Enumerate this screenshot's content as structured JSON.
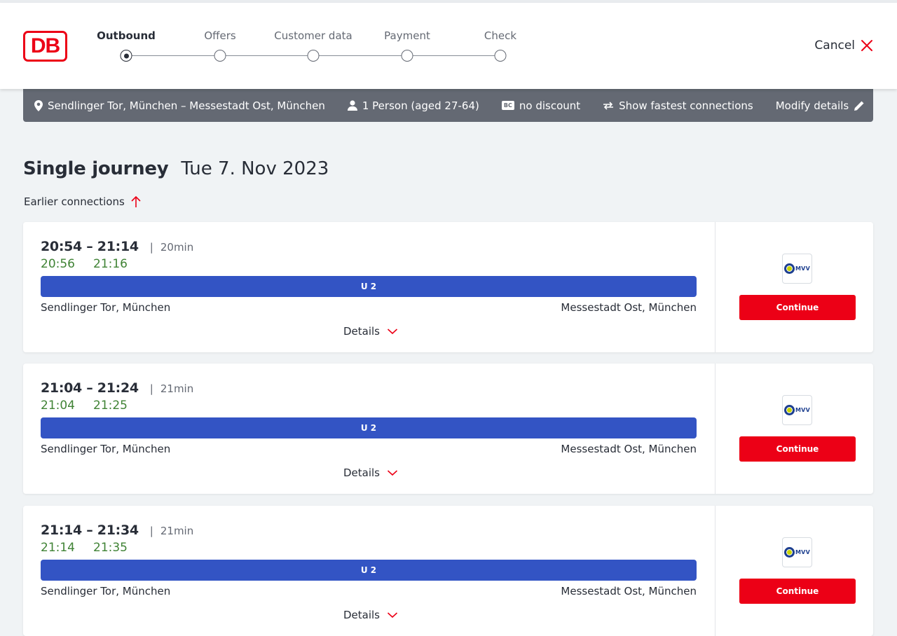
{
  "header": {
    "logo_text": "DB",
    "steps": [
      {
        "label": "Outbound",
        "active": true
      },
      {
        "label": "Offers",
        "active": false
      },
      {
        "label": "Customer data",
        "active": false
      },
      {
        "label": "Payment",
        "active": false
      },
      {
        "label": "Check",
        "active": false
      }
    ],
    "cancel_label": "Cancel"
  },
  "filter_bar": {
    "route": "Sendlinger Tor, München – Messestadt Ost, München",
    "passengers": "1 Person (aged 27-64)",
    "bc_badge": "BC",
    "discount": "no discount",
    "sort": "Show fastest connections",
    "modify": "Modify details"
  },
  "page": {
    "title": "Single journey",
    "date": "Tue 7. Nov 2023",
    "earlier_connections": "Earlier connections"
  },
  "connections": [
    {
      "departure": "20:54",
      "arrival": "21:14",
      "times": "20:54 – 21:14",
      "duration": "20min",
      "rt_departure": "20:56",
      "rt_arrival": "21:16",
      "line": "U 2",
      "from": "Sendlinger Tor, München",
      "to": "Messestadt Ost, München",
      "details_label": "Details",
      "operator": "MVV",
      "continue_label": "Continue"
    },
    {
      "departure": "21:04",
      "arrival": "21:24",
      "times": "21:04 – 21:24",
      "duration": "21min",
      "rt_departure": "21:04",
      "rt_arrival": "21:25",
      "line": "U 2",
      "from": "Sendlinger Tor, München",
      "to": "Messestadt Ost, München",
      "details_label": "Details",
      "operator": "MVV",
      "continue_label": "Continue"
    },
    {
      "departure": "21:14",
      "arrival": "21:34",
      "times": "21:14 – 21:34",
      "duration": "21min",
      "rt_departure": "21:14",
      "rt_arrival": "21:35",
      "line": "U 2",
      "from": "Sendlinger Tor, München",
      "to": "Messestadt Ost, München",
      "details_label": "Details",
      "operator": "MVV",
      "continue_label": "Continue"
    }
  ],
  "colors": {
    "brand_red": "#ec0016",
    "line_u2": "#3354c4",
    "realtime_green": "#408335",
    "filter_bar_bg": "#646973"
  }
}
